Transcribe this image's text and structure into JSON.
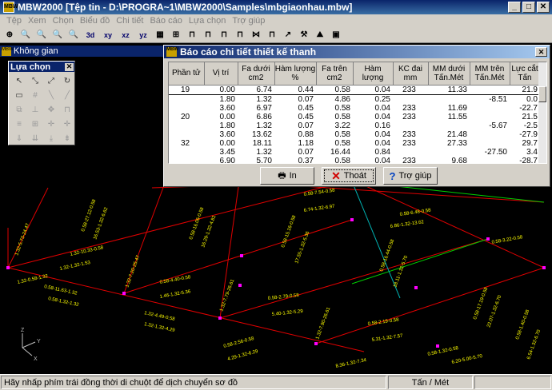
{
  "window": {
    "title": "MBW2000 [Tệp tin - D:\\PROGRA~1\\MBW2000\\Samples\\mbgiaonhau.mbw]",
    "icon": "MBW"
  },
  "menu": [
    "Tệp",
    "Xem",
    "Chọn",
    "Biểu đồ",
    "Chi tiết",
    "Báo cáo",
    "Lựa chọn",
    "Trợ giúp"
  ],
  "toolbar": {
    "icons": [
      "zoom-window-icon",
      "zoom-in-icon",
      "zoom-out-icon",
      "zoom-previous-icon",
      "zoom-all-icon"
    ],
    "views": [
      "3d",
      "xy",
      "xz",
      "yz"
    ],
    "tools": [
      "grid-icon",
      "frame-icon",
      "beam-icon",
      "beam-icon",
      "beam-icon",
      "beam-icon",
      "beam-icon",
      "beam-icon",
      "arrow-icon",
      "hammer-icon",
      "chart-icon",
      "box-icon"
    ]
  },
  "space_panel": {
    "title": "Không gian"
  },
  "selection_palette": {
    "title": "Lựa chọn",
    "close": "✕"
  },
  "dialog": {
    "title": "Báo cáo chi tiết thiết kế thanh",
    "close": "✕",
    "columns": [
      "Phần tử",
      "Vị trí",
      "Fa dưới cm2",
      "Hàm lượng %",
      "Fa trên cm2",
      "Hàm lượng",
      "KC đai mm",
      "MM dưới Tấn.Mét",
      "MM trên Tấn.Mét",
      "Lực cắt Tấn"
    ],
    "rows": [
      [
        "19",
        "0.00",
        "6.74",
        "0.44",
        "0.58",
        "0.04",
        "233",
        "11.33",
        "",
        "21.9"
      ],
      [
        "",
        "1.80",
        "1.32",
        "0.07",
        "4.86",
        "0.25",
        "",
        "",
        "-8.51",
        "0.0"
      ],
      [
        "",
        "3.60",
        "6.97",
        "0.45",
        "0.58",
        "0.04",
        "233",
        "11.69",
        "",
        "-22.7"
      ],
      [
        "20",
        "0.00",
        "6.86",
        "0.45",
        "0.58",
        "0.04",
        "233",
        "11.55",
        "",
        "21.5"
      ],
      [
        "",
        "1.80",
        "1.32",
        "0.07",
        "3.22",
        "0.16",
        "",
        "",
        "-5.67",
        "-2.5"
      ],
      [
        "",
        "3.60",
        "13.62",
        "0.88",
        "0.58",
        "0.04",
        "233",
        "21.48",
        "",
        "-27.9"
      ],
      [
        "32",
        "0.00",
        "18.11",
        "1.18",
        "0.58",
        "0.04",
        "233",
        "27.33",
        "",
        "29.7"
      ],
      [
        "",
        "3.45",
        "1.32",
        "0.07",
        "16.44",
        "0.84",
        "",
        "",
        "-27.50",
        "3.4"
      ],
      [
        "",
        "6.90",
        "5.70",
        "0.37",
        "0.58",
        "0.04",
        "233",
        "9.68",
        "",
        "-28.7"
      ]
    ],
    "buttons": {
      "print": "In",
      "exit": "Thoát",
      "help": "Trợ giúp"
    }
  },
  "canvas_labels": [
    "0.58-7.54-0.58",
    "0.58-6.48-0.58",
    "0.58-3.22-0.58",
    "6.74-1.32-6.97",
    "6.86-1.32-13.62",
    "0.58-15.16-0.58",
    "17.55-1.32-5.36",
    "0.58-16.44-0.58",
    "18.11-1.32-5.70",
    "0.58-2.79-0.58",
    "5.40-1.32-5.29",
    "0.58-2.19-0.58",
    "5.31-1.32-7.57",
    "0.58-1.32-0.58",
    "6.20-5.00-5.70",
    "1.32-0.58-1.32",
    "1.32-10.33-0.58",
    "1.32-1.32-1.53",
    "0.58-11.63-1.32",
    "0.58-1.32-1.32",
    "0.58-4.40-0.58",
    "1.46-1.32-5.36",
    "1.32-4.49-0.58",
    "1.32-1.32-4.29",
    "0.58-2.56-0.58",
    "4.29-1.32-6.29",
    "0.58-17.19-0.58",
    "22.07-1.32-6.70",
    "0.58-1.40-0.58",
    "6.54-1.32-6.70",
    "0.58-27.12-0.58",
    "16.53-1.32-6.62",
    "0.58-16.06-0.58",
    "16.29-1.32-4.81",
    "1.32-5.73-24.47",
    "1.32-7.20-25.47",
    "1.32-7.79-26.61",
    "1.32-7.90-26.61",
    "8.36-1.32-7.34"
  ],
  "axis": {
    "x": "X",
    "y": "Y",
    "z": "Z"
  },
  "status": {
    "hint": "Hãy nhấp phím trái đồng thời di chuột để dịch chuyển sơ đồ",
    "units": "Tấn / Mét"
  }
}
